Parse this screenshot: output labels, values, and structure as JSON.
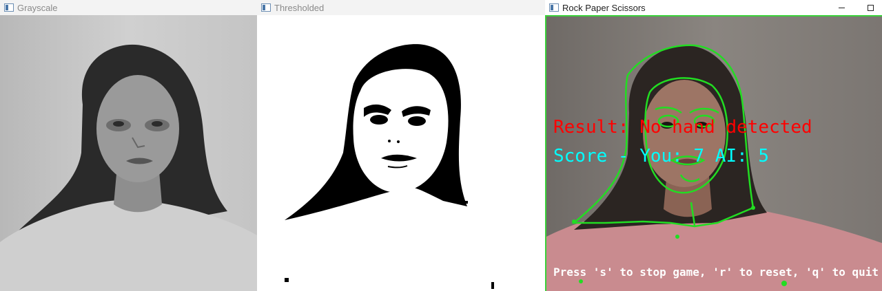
{
  "windows": {
    "grayscale": {
      "title": "Grayscale"
    },
    "thresholded": {
      "title": "Thresholded"
    },
    "rps": {
      "title": "Rock Paper Scissors",
      "result_text": "Result: No hand detected",
      "score_text": "Score - You: 7  AI: 5",
      "help_text": "Press 's' to stop game, 'r' to reset, 'q' to quit"
    }
  },
  "colors": {
    "result": "#ff0000",
    "score": "#00ffff",
    "contour": "#22dd22",
    "help": "#ffffff"
  },
  "icons": {
    "window": "opencv-window-icon",
    "minimize": "minimize-icon",
    "maximize": "maximize-icon"
  }
}
